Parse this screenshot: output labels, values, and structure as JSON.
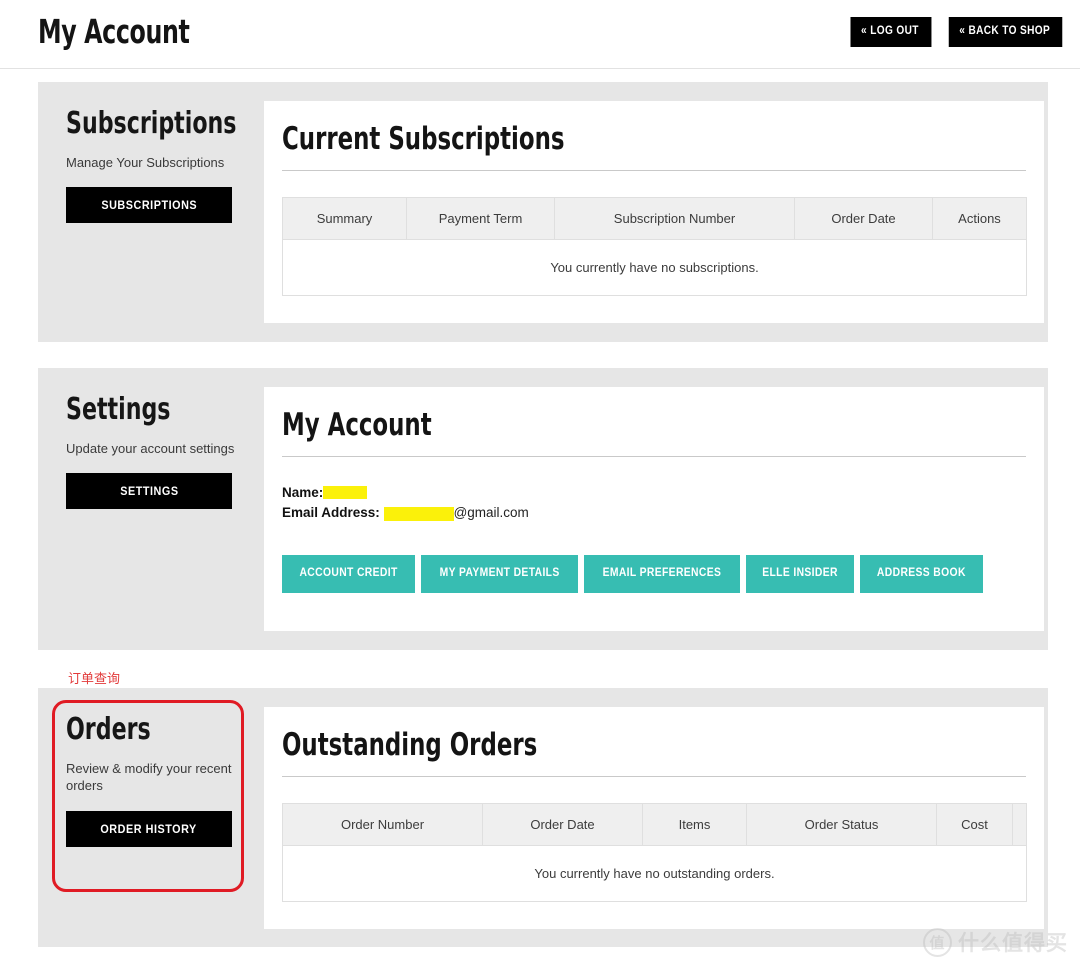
{
  "header": {
    "title": "My Account",
    "buttons": [
      {
        "label": "« LOG OUT",
        "name": "log-out-button"
      },
      {
        "label": "« BACK TO SHOP",
        "name": "back-to-shop-button"
      }
    ]
  },
  "subscriptions_section": {
    "side_title": "Subscriptions",
    "side_desc": "Manage Your Subscriptions",
    "side_button": "SUBSCRIPTIONS",
    "panel_title": "Current Subscriptions",
    "table": {
      "columns": [
        "Summary",
        "Payment Term",
        "Subscription Number",
        "Order Date",
        "Actions"
      ],
      "empty_message": "You currently have no subscriptions."
    }
  },
  "settings_section": {
    "side_title": "Settings",
    "side_desc": "Update your account settings",
    "side_button": "SETTINGS",
    "panel_title": "My Account",
    "details": {
      "name_label": "Name:",
      "name_value": "",
      "email_label": "Email Address:",
      "email_value": "",
      "email_domain": "@gmail.com"
    },
    "buttons": [
      {
        "label": "ACCOUNT CREDIT",
        "name": "account-credit-button"
      },
      {
        "label": "MY PAYMENT DETAILS",
        "name": "my-payment-details-button"
      },
      {
        "label": "EMAIL PREFERENCES",
        "name": "email-preferences-button"
      },
      {
        "label": "ELLE INSIDER",
        "name": "elle-insider-button"
      },
      {
        "label": "ADDRESS BOOK",
        "name": "address-book-button"
      }
    ]
  },
  "orders_section": {
    "side_title": "Orders",
    "side_desc": "Review & modify your recent orders",
    "side_button": "ORDER HISTORY",
    "panel_title": "Outstanding Orders",
    "table": {
      "columns": [
        "Order Number",
        "Order Date",
        "Items",
        "Order Status",
        "Cost",
        ""
      ],
      "empty_message": "You currently have no outstanding orders."
    }
  },
  "annotation": {
    "label": "订单查询"
  },
  "watermark": {
    "badge": "值",
    "text": "什么值得买"
  },
  "colors": {
    "accent_teal": "#37bdb2",
    "section_gray": "#e6e6e6",
    "annotation_red": "#e01b24",
    "redaction_yellow": "#fbf10a",
    "button_black": "#000000"
  }
}
